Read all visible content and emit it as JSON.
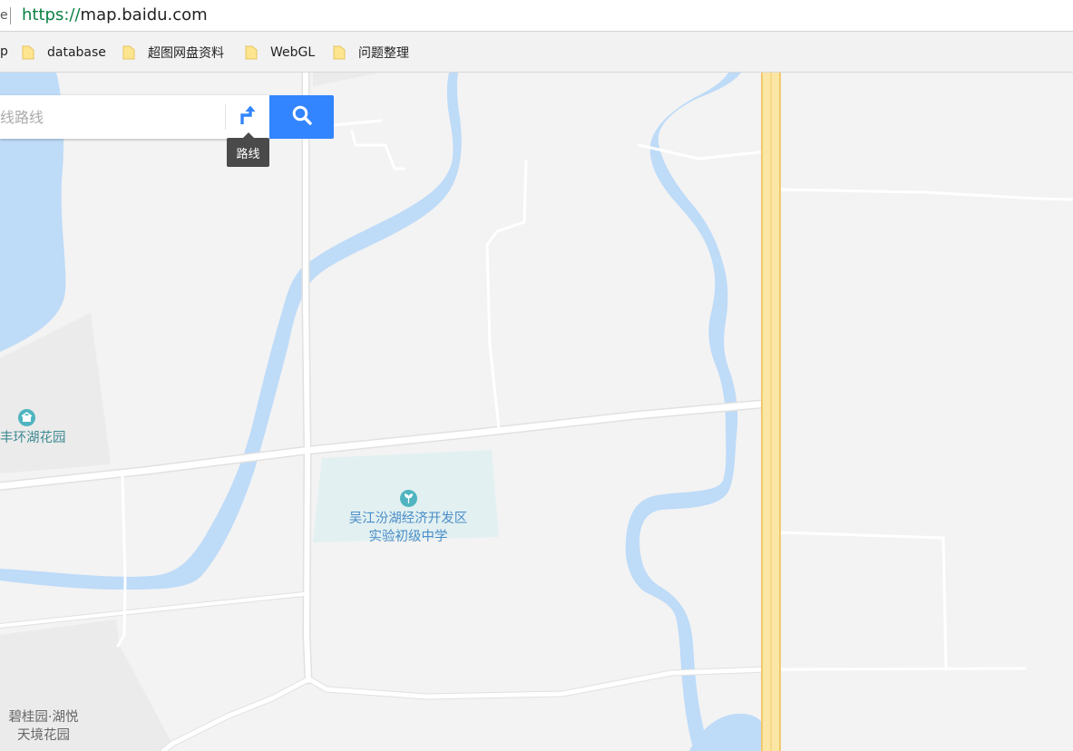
{
  "browser": {
    "address_edge_glyph": "e",
    "url_scheme": "https://",
    "url_rest": "map.baidu.com"
  },
  "bookmarks": {
    "truncated_label": "p",
    "items": [
      {
        "label": "database",
        "icon": "folder-icon"
      },
      {
        "label": "超图网盘资料",
        "icon": "folder-icon"
      },
      {
        "label": "WebGL",
        "icon": "folder-icon"
      },
      {
        "label": "问题整理",
        "icon": "folder-icon"
      }
    ]
  },
  "search": {
    "placeholder": "线路线",
    "route_icon": "route-arrow-icon",
    "search_icon": "search-icon",
    "route_tooltip": "路线"
  },
  "map": {
    "pois": [
      {
        "name": "丰环湖花园",
        "icon": "residence-icon"
      },
      {
        "line1": "吴江汾湖经济开发区",
        "line2": "实验初级中学",
        "icon": "school-icon"
      },
      {
        "line1": "碧桂园·湖悦",
        "line2": "天境花园"
      }
    ]
  },
  "colors": {
    "water": "#bedbf8",
    "road": "#ffffff",
    "highway": "#fbe6a5",
    "highway_edge": "#f1c96b",
    "land": "#f3f3f3",
    "school_area": "#e2f0f1",
    "residential_area": "#e9e9e9",
    "accent": "#3385ff"
  }
}
